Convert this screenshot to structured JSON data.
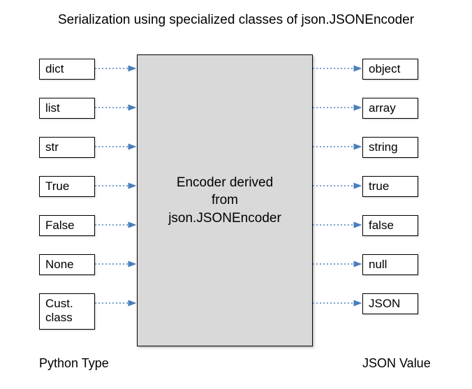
{
  "title": "Serialization using specialized classes of json.JSONEncoder",
  "center": {
    "line1": "Encoder derived",
    "line2": "from",
    "line3": "json.JSONEncoder"
  },
  "left": {
    "items": [
      {
        "label": "dict"
      },
      {
        "label": "list"
      },
      {
        "label": "str"
      },
      {
        "label": "True"
      },
      {
        "label": "False"
      },
      {
        "label": "None"
      },
      {
        "label": "Cust.\nclass"
      }
    ],
    "footer": "Python Type"
  },
  "right": {
    "items": [
      {
        "label": "object"
      },
      {
        "label": "array"
      },
      {
        "label": "string"
      },
      {
        "label": "true"
      },
      {
        "label": "false"
      },
      {
        "label": "null"
      },
      {
        "label": "JSON"
      }
    ],
    "footer": "JSON Value"
  },
  "chart_data": {
    "type": "table",
    "title": "Serialization using specialized classes of json.JSONEncoder",
    "mapping_via": "Encoder derived from json.JSONEncoder",
    "columns": [
      "Python Type",
      "JSON Value"
    ],
    "rows": [
      [
        "dict",
        "object"
      ],
      [
        "list",
        "array"
      ],
      [
        "str",
        "string"
      ],
      [
        "True",
        "true"
      ],
      [
        "False",
        "false"
      ],
      [
        "None",
        "null"
      ],
      [
        "Cust. class",
        "JSON"
      ]
    ]
  }
}
